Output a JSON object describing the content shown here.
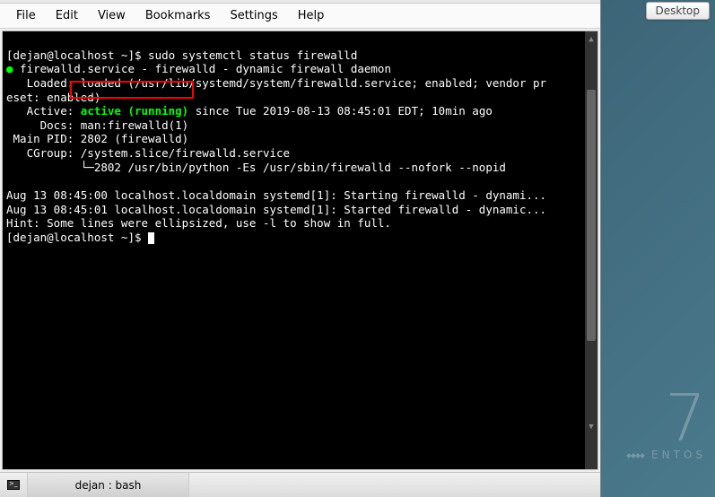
{
  "menubar": {
    "items": [
      "File",
      "Edit",
      "View",
      "Bookmarks",
      "Settings",
      "Help"
    ]
  },
  "terminal": {
    "prompt1_user": "[dejan@localhost ~]$ ",
    "prompt1_cmd": "sudo systemctl status firewalld",
    "line2_dot": "●",
    "line2": " firewalld.service - firewalld - dynamic firewall daemon",
    "line3": "   Loaded: loaded (/usr/lib/systemd/system/firewalld.service; enabled; vendor pr",
    "line4": "eset: enabled)",
    "line5_pre": "   Active: ",
    "line5_status": "active (running)",
    "line5_post": " since Tue 2019-08-13 08:45:01 EDT; 10min ago",
    "line6": "     Docs: man:firewalld(1)",
    "line7": " Main PID: 2802 (firewalld)",
    "line8": "   CGroup: /system.slice/firewalld.service",
    "line9": "           └─2802 /usr/bin/python -Es /usr/sbin/firewalld --nofork --nopid",
    "line10": "",
    "line11": "Aug 13 08:45:00 localhost.localdomain systemd[1]: Starting firewalld - dynami...",
    "line12": "Aug 13 08:45:01 localhost.localdomain systemd[1]: Started firewalld - dynamic...",
    "line13": "Hint: Some lines were ellipsized, use -l to show in full.",
    "prompt2": "[dejan@localhost ~]$ "
  },
  "taskbar": {
    "tab_label": "dejan : bash"
  },
  "desktop": {
    "button_label": "Desktop",
    "brand_number": "7",
    "brand_text": "ENTOS"
  }
}
